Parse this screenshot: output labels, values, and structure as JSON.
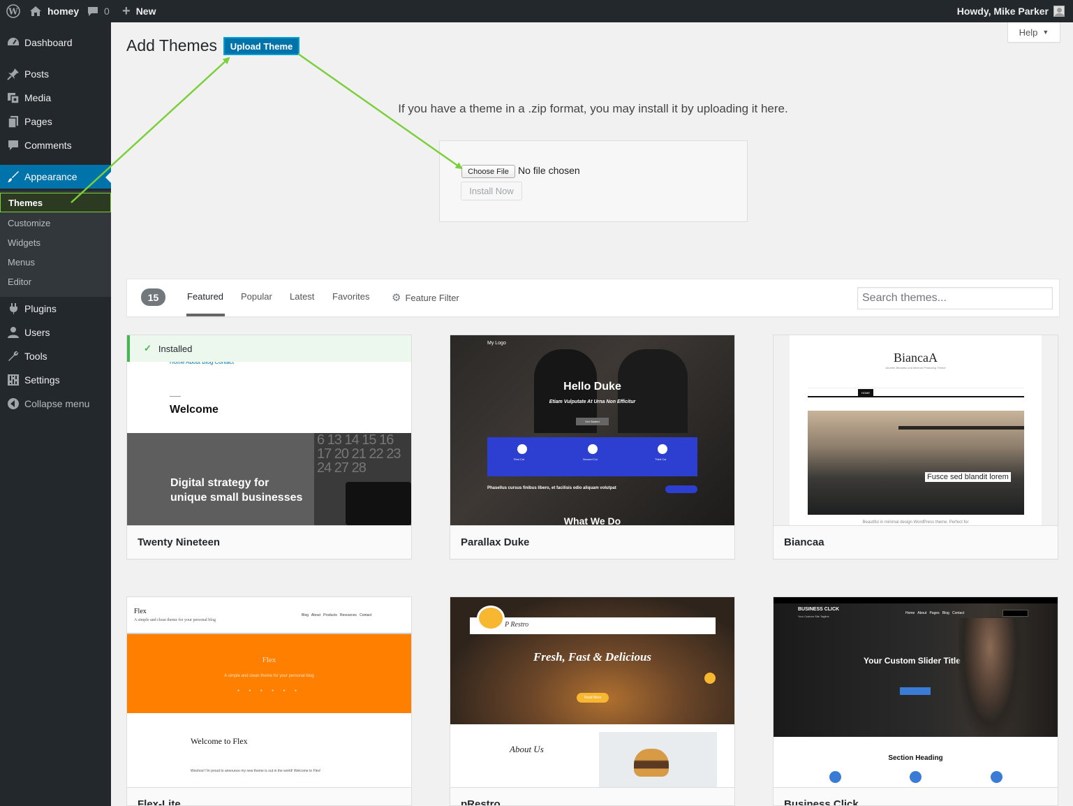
{
  "admin_bar": {
    "site_name": "homey",
    "comments_count": "0",
    "new_label": "New",
    "howdy": "Howdy, Mike Parker"
  },
  "sidebar": {
    "items": [
      {
        "label": "Dashboard",
        "icon": "dashboard-icon"
      },
      {
        "label": "Posts",
        "icon": "pin-icon"
      },
      {
        "label": "Media",
        "icon": "media-icon"
      },
      {
        "label": "Pages",
        "icon": "pages-icon"
      },
      {
        "label": "Comments",
        "icon": "comment-icon"
      },
      {
        "label": "Appearance",
        "icon": "brush-icon"
      },
      {
        "label": "Plugins",
        "icon": "plug-icon"
      },
      {
        "label": "Users",
        "icon": "user-icon"
      },
      {
        "label": "Tools",
        "icon": "wrench-icon"
      },
      {
        "label": "Settings",
        "icon": "settings-icon"
      },
      {
        "label": "Collapse menu",
        "icon": "collapse-icon"
      }
    ],
    "submenu": [
      "Themes",
      "Customize",
      "Widgets",
      "Menus",
      "Editor"
    ]
  },
  "header": {
    "title": "Add Themes",
    "upload_button": "Upload Theme",
    "help": "Help"
  },
  "upload": {
    "description": "If you have a theme in a .zip format, you may install it by uploading it here.",
    "choose_file": "Choose File",
    "no_file": "No file chosen",
    "install_now": "Install Now"
  },
  "filter": {
    "count": "15",
    "tabs": [
      "Featured",
      "Popular",
      "Latest",
      "Favorites"
    ],
    "feature_filter": "Feature Filter",
    "search_placeholder": "Search themes..."
  },
  "themes": [
    {
      "name": "Twenty Nineteen",
      "installed_label": "Installed",
      "shot": {
        "nav": "Home  About  Blog  Contact",
        "welcome": "Welcome",
        "headline_1": "Digital strategy for",
        "headline_2": "unique small businesses",
        "numbers": "6 13 14 15 16 17 20 21 22 23 24 27 28"
      }
    },
    {
      "name": "Parallax Duke",
      "shot": {
        "logo": "My Logo",
        "title": "Hello Duke",
        "subtitle": "Etiam Vulputate At Urna Non Efficitur",
        "button": "Get Started",
        "col1": "First Col",
        "col2": "Second Col",
        "col3": "Third Col",
        "strip": "Phasellus cursus finibus libero, et facilisis odio aliquam volutpat",
        "section": "What We Do"
      }
    },
    {
      "name": "Biancaa",
      "shot": {
        "logo": "BiancaA",
        "tagline": "Another Beautiful and Minimal Photoblog Theme",
        "menu": "HOME",
        "caption": "Fusce sed blandit lorem",
        "footer": "Beautiful in minimal design WordPress theme. Perfect for"
      }
    },
    {
      "name": "Flex-Lite",
      "shot": {
        "logo": "Flex",
        "tagline": "A simple and clean theme for your personal blog",
        "nav": "Blog   About   Products   Resources   Contact",
        "hero_title": "Flex",
        "hero_sub": "A simple and clean theme for your personal blog",
        "post_title": "Welcome to Flex",
        "post_text": "Woohoo! I'm proud to announce my new theme is out in the world! Welcome to Flex!"
      }
    },
    {
      "name": "pRestro",
      "shot": {
        "logo": "P Restro",
        "headline": "Fresh, Fast & Delicious",
        "button": "Read More",
        "about": "About Us"
      }
    },
    {
      "name": "Business Click",
      "shot": {
        "logo": "BUSINESS CLICK",
        "tagline": "Your Custom Site Tagline",
        "nav": "Home   About   Pages   Blog   Contact",
        "title": "Your Custom Slider Title 2",
        "section": "Section Heading"
      }
    }
  ],
  "colors": {
    "admin_bg": "#23282d",
    "accent": "#0073aa",
    "arrow": "#7ad03a",
    "installed": "#46b450"
  }
}
